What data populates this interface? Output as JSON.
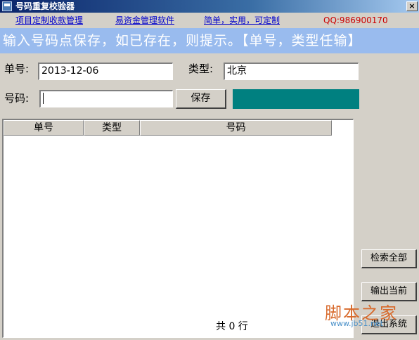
{
  "window": {
    "title": "号码重复校验器",
    "close_label": "×"
  },
  "menu": {
    "link1": "项目定制收款管理",
    "link2": "易资金管理软件",
    "link3": "简单，实用，可定制",
    "qq": "QQ:986900170"
  },
  "banner": {
    "text": "输入号码点保存，如已存在，则提示。【单号，类型任输】"
  },
  "form": {
    "order_label": "单号:",
    "order_value": "2013-12-06",
    "type_label": "类型:",
    "type_value": "北京",
    "number_label": "号码:",
    "number_value": "",
    "save_label": "保存",
    "status_color": "#008080"
  },
  "table": {
    "columns": [
      "单号",
      "类型",
      "号码"
    ],
    "rows": [],
    "count_text": "共 0 行"
  },
  "buttons": {
    "search_all": "检索全部",
    "export_current": "输出当前",
    "exit": "退出系统"
  },
  "watermark": {
    "text": "脚本之家",
    "url": "www.jb51.net"
  }
}
